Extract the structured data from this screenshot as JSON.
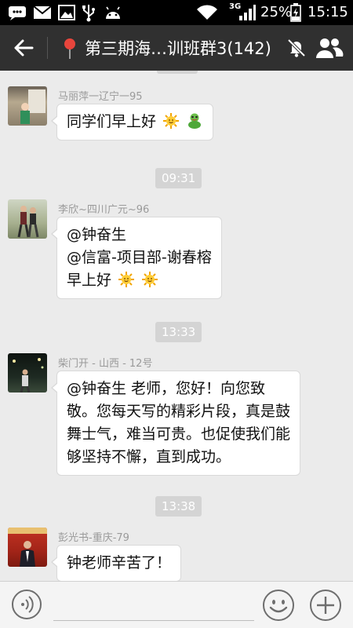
{
  "status_bar": {
    "network": "3G",
    "battery": "25%",
    "time": "15:15"
  },
  "header": {
    "title": "第三期海…训班群3(142)"
  },
  "messages": [
    {
      "sender": "马丽萍一辽宁一95",
      "lines": [
        "同学们早上好"
      ],
      "emoji_last_line": [
        "sun",
        "frog"
      ]
    },
    {
      "timestamp": "09:31"
    },
    {
      "sender": "李欣~四川广元~96",
      "lines": [
        "@钟奋生",
        "@信富-项目部-谢春榕",
        "早上好"
      ],
      "emoji_last_line": [
        "sun",
        "sun"
      ]
    },
    {
      "timestamp": "13:33"
    },
    {
      "sender": "柴门开 - 山西 - 12号",
      "lines": [
        "@钟奋生 老师，您好！向您致",
        "敬。您每天写的精彩片段，真是鼓",
        "舞士气，难当可贵。也促使我们能",
        "够坚持不懈，直到成功。"
      ]
    },
    {
      "timestamp": "13:38"
    },
    {
      "sender": "彭光书-重庆-79",
      "lines": [
        "钟老师辛苦了！"
      ]
    }
  ],
  "colors": {
    "title_bar": "#303030",
    "chat_bg": "#ebebeb",
    "bubble_bg": "#ffffff",
    "timestamp_bg": "#d4d4d4"
  },
  "icons": [
    "wechat-notify-icon",
    "mail-icon",
    "gallery-icon",
    "usb-icon",
    "android-icon",
    "wifi-icon",
    "signal-icon",
    "battery-icon",
    "back-arrow-icon",
    "location-pin-icon",
    "mute-icon",
    "group-members-icon",
    "voice-input-icon",
    "emoji-icon",
    "plus-icon"
  ]
}
